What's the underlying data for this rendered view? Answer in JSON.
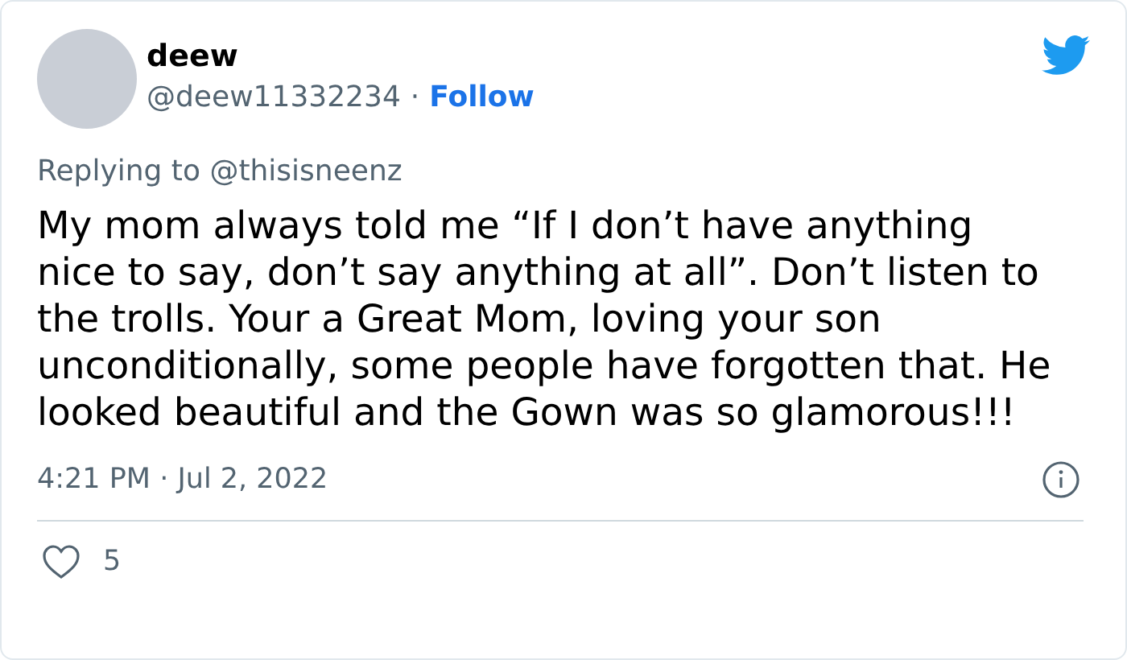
{
  "author": {
    "name": "deew",
    "handle": "@deew11332234",
    "separator": "·",
    "follow": "Follow"
  },
  "reply_to": "Replying to @thisisneenz",
  "text": "My mom always told me “If I don’t have anything nice to say, don’t say anything at all”. Don’t listen to the trolls. Your a Great Mom, loving your son unconditionally, some people have forgotten that. He looked beautiful and the Gown was so glamorous!!!",
  "timestamp": "4:21 PM · Jul 2, 2022",
  "likes": "5"
}
